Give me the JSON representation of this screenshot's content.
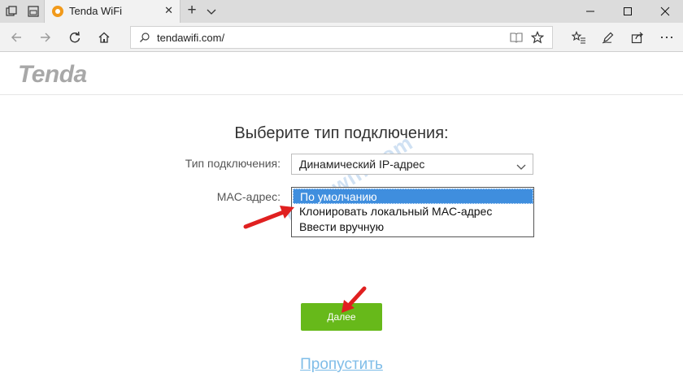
{
  "browser": {
    "tab_title": "Tenda WiFi",
    "url": "tendawifi.com/"
  },
  "page": {
    "logo": "Tenda",
    "heading": "Выберите тип подключения:",
    "connection_type": {
      "label": "Тип подключения:",
      "value": "Динамический IP-адрес"
    },
    "mac": {
      "label": "MAC-адрес:",
      "options": [
        "По умолчанию",
        "Клонировать локальный MAC-адрес",
        "Ввести вручную"
      ],
      "selected_index": 0
    },
    "next_button": "Далее",
    "skip_link": "Пропустить",
    "watermark": "help-wifi.com"
  },
  "colors": {
    "button_green": "#67b91a",
    "selected_option": "#3f8ede",
    "skip_link": "#7fbde8",
    "annotation_arrow": "#e02020"
  }
}
